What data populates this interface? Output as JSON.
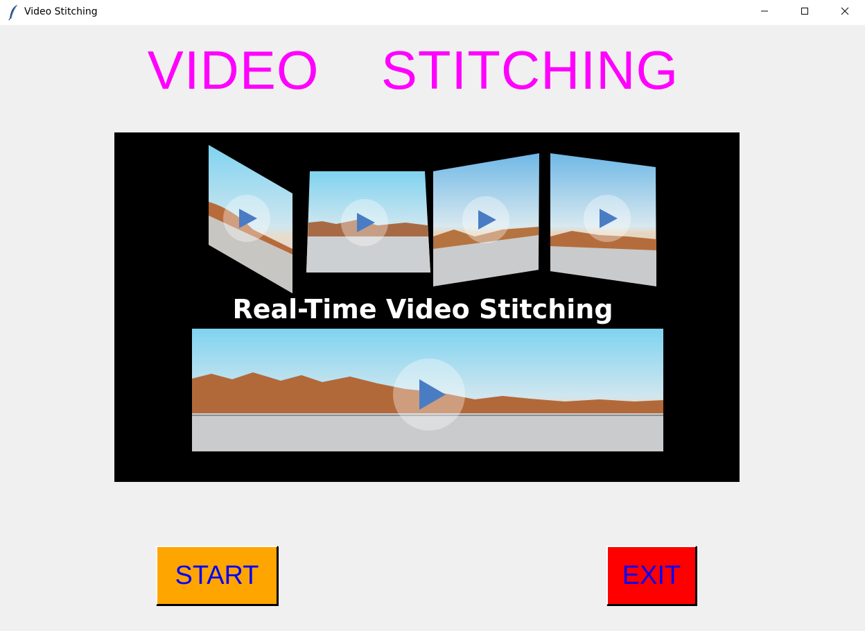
{
  "window": {
    "title": "Video Stitching",
    "icon": "feather-icon",
    "controls": [
      "minimize-icon",
      "maximize-icon",
      "close-icon"
    ]
  },
  "heading": {
    "text": "VIDEO  STITCHING",
    "color": "#ff00ff"
  },
  "banner": {
    "caption": "Real-Time Video Stitching",
    "background": "#000000",
    "icon": "play-icon",
    "play_color": "#4a7cc4"
  },
  "buttons": {
    "start": {
      "label": "START",
      "background": "#ffa500",
      "text_color": "#0000ff"
    },
    "exit": {
      "label": "EXIT",
      "background": "#ff0000",
      "text_color": "#0000ff"
    }
  }
}
